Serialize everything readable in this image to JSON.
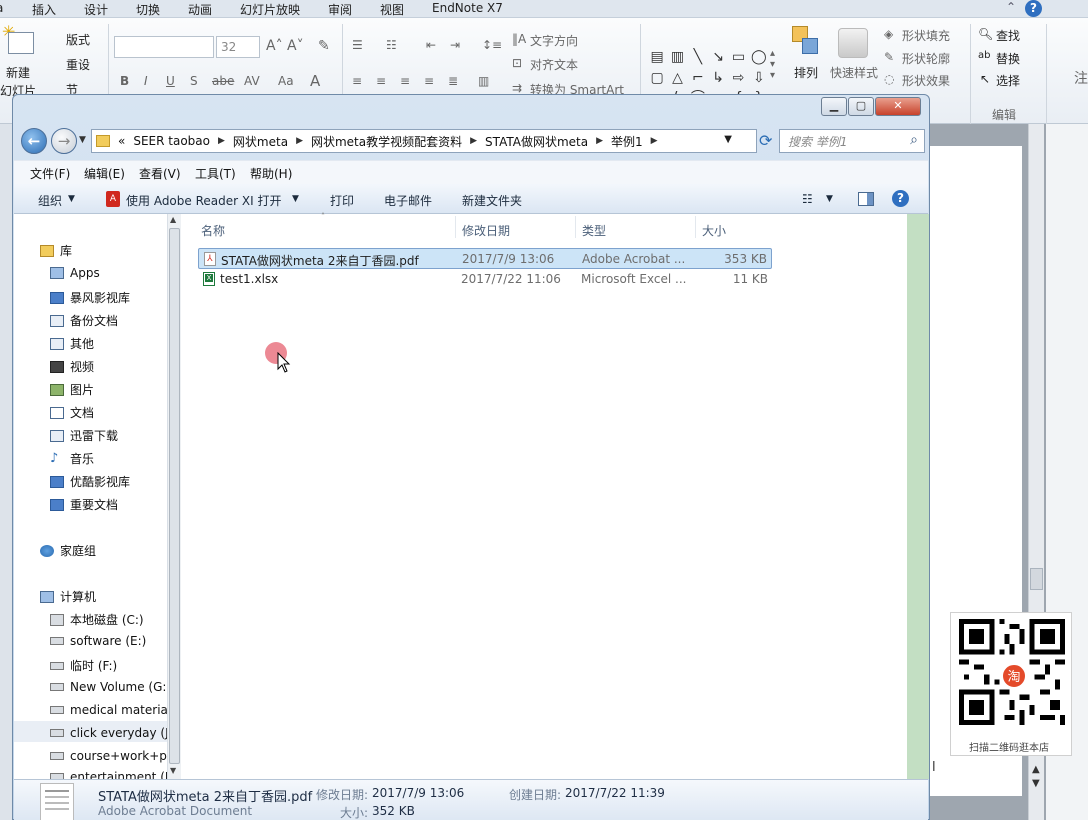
{
  "ribbon": {
    "tabs": [
      "插入",
      "设计",
      "切换",
      "动画",
      "幻灯片放映",
      "审阅",
      "视图",
      "EndNote X7"
    ],
    "cut_off_tab": "a",
    "new_slide": "新建",
    "new_slide_sub": "幻灯片",
    "layout": "版式",
    "reset": "重设",
    "section": "节",
    "font_size": "32",
    "text_direction": "文字方向",
    "align_text": "对齐文本",
    "convert_smartart": "转换为 SmartArt",
    "arrange": "排列",
    "quick_styles": "快速样式",
    "shape_fill": "形状填充",
    "shape_outline": "形状轮廓",
    "shape_effects": "形状效果",
    "find": "查找",
    "replace": "替换",
    "select": "选择",
    "editing_group": "编辑",
    "right_edge_label": "注"
  },
  "window": {
    "back_arrow": "←",
    "address_crumbs": [
      "SEER taobao",
      "网状meta",
      "网状meta教学视频配套资料",
      "STATA做网状meta",
      "举例1"
    ],
    "address_prefix": "«",
    "search_placeholder": "搜索 举例1",
    "menu": [
      "文件(F)",
      "编辑(E)",
      "查看(V)",
      "工具(T)",
      "帮助(H)"
    ],
    "commands": {
      "organize": "组织",
      "open_with": "使用 Adobe Reader XI 打开",
      "print": "打印",
      "email": "电子邮件",
      "new_folder": "新建文件夹"
    },
    "nav_tree": {
      "libraries": "库",
      "library_items": [
        "Apps",
        "暴风影视库",
        "备份文档",
        "其他",
        "视频",
        "图片",
        "文档",
        "迅雷下载",
        "音乐",
        "优酷影视库",
        "重要文档"
      ],
      "homegroup": "家庭组",
      "computer": "计算机",
      "drives": [
        "本地磁盘 (C:)",
        "software (E:)",
        "临时 (F:)",
        "New Volume (G:",
        "medical materia",
        "click everyday (J",
        "course+work+p",
        "entertainment (N"
      ]
    },
    "columns": [
      "名称",
      "修改日期",
      "类型",
      "大小"
    ],
    "files": [
      {
        "name": "STATA做网状meta 2来自丁香园.pdf",
        "modified": "2017/7/9 13:06",
        "type": "Adobe Acrobat ...",
        "size": "353 KB",
        "icon": "pdf-icon",
        "selected": true
      },
      {
        "name": "test1.xlsx",
        "modified": "2017/7/22 11:06",
        "type": "Microsoft Excel ...",
        "size": "11 KB",
        "icon": "excel-icon",
        "selected": false
      }
    ],
    "details": {
      "filename": "STATA做网状meta 2来自丁香园.pdf",
      "filetype": "Adobe Acrobat Document",
      "modified_label": "修改日期:",
      "modified_value": "2017/7/9 13:06",
      "created_label": "创建日期:",
      "created_value": "2017/7/22 11:39",
      "size_label": "大小:",
      "size_value": "352 KB"
    }
  },
  "qr": {
    "caption": "扫描二维码逛本店",
    "logo_char": "淘"
  },
  "colors": {
    "selection_bg": "#cce4f7",
    "selection_border": "#7da2ce",
    "accent_blue": "#2c6db4",
    "pdf_red": "#d0281e",
    "excel_green": "#1e7a3c"
  }
}
